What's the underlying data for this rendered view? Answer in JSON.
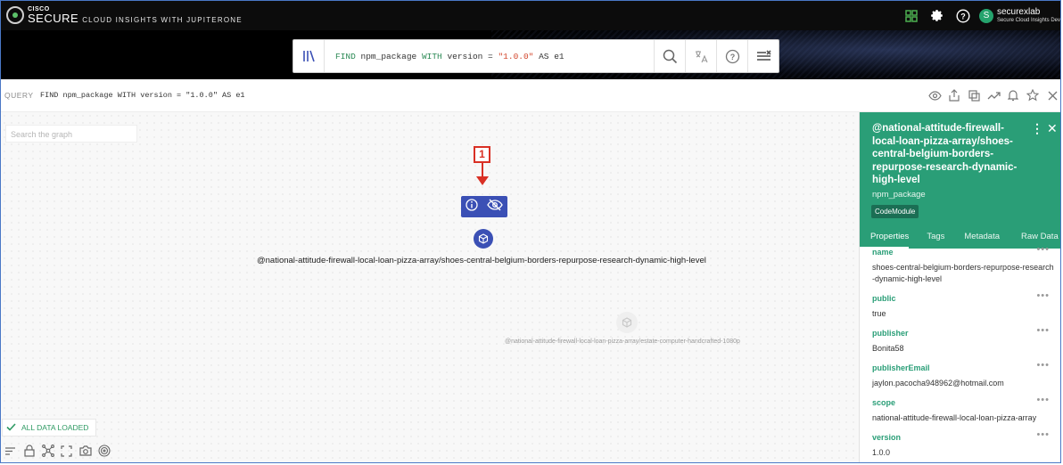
{
  "app": {
    "brand_small": "CISCO",
    "brand_big": "SECURE",
    "brand_rest": "CLOUD INSIGHTS WITH JUPITERONE",
    "user_initial": "S",
    "user_name": "securexlab",
    "user_org": "Secure Cloud Insights Dev"
  },
  "search": {
    "query_parts": {
      "find": "FIND",
      "entity": " npm_package ",
      "with": "WITH",
      "cond": " version = ",
      "value": "\"1.0.0\"",
      "as": " AS e1"
    }
  },
  "query_bar": {
    "label": "QUERY",
    "text": "FIND npm_package WITH version = \"1.0.0\" AS e1"
  },
  "graph": {
    "search_placeholder": "Search the graph",
    "callout_number": "1",
    "node1_label": "@national-attitude-firewall-local-loan-pizza-array/shoes-central-belgium-borders-repurpose-research-dynamic-high-level",
    "node2_label": "@national-attitude-firewall-local-loan-pizza-array/estate-computer-handcrafted-1080p",
    "status": "ALL DATA LOADED"
  },
  "panel": {
    "title": "@national-attitude-firewall-local-loan-pizza-array/shoes-central-belgium-borders-repurpose-research-dynamic-high-level",
    "type": "npm_package",
    "badge": "CodeModule",
    "tabs": [
      "Properties",
      "Tags",
      "Metadata",
      "Raw Data"
    ],
    "properties": [
      {
        "name": "name",
        "value": "shoes-central-belgium-borders-repurpose-research-dynamic-high-level"
      },
      {
        "name": "public",
        "value": "true"
      },
      {
        "name": "publisher",
        "value": "Bonita58"
      },
      {
        "name": "publisherEmail",
        "value": "jaylon.pacocha948962@hotmail.com"
      },
      {
        "name": "scope",
        "value": "national-attitude-firewall-local-loan-pizza-array"
      },
      {
        "name": "version",
        "value": "1.0.0"
      }
    ]
  },
  "colors": {
    "accent_green": "#2a9e77",
    "node_blue": "#3b50b5",
    "annotation_red": "#d93025"
  }
}
